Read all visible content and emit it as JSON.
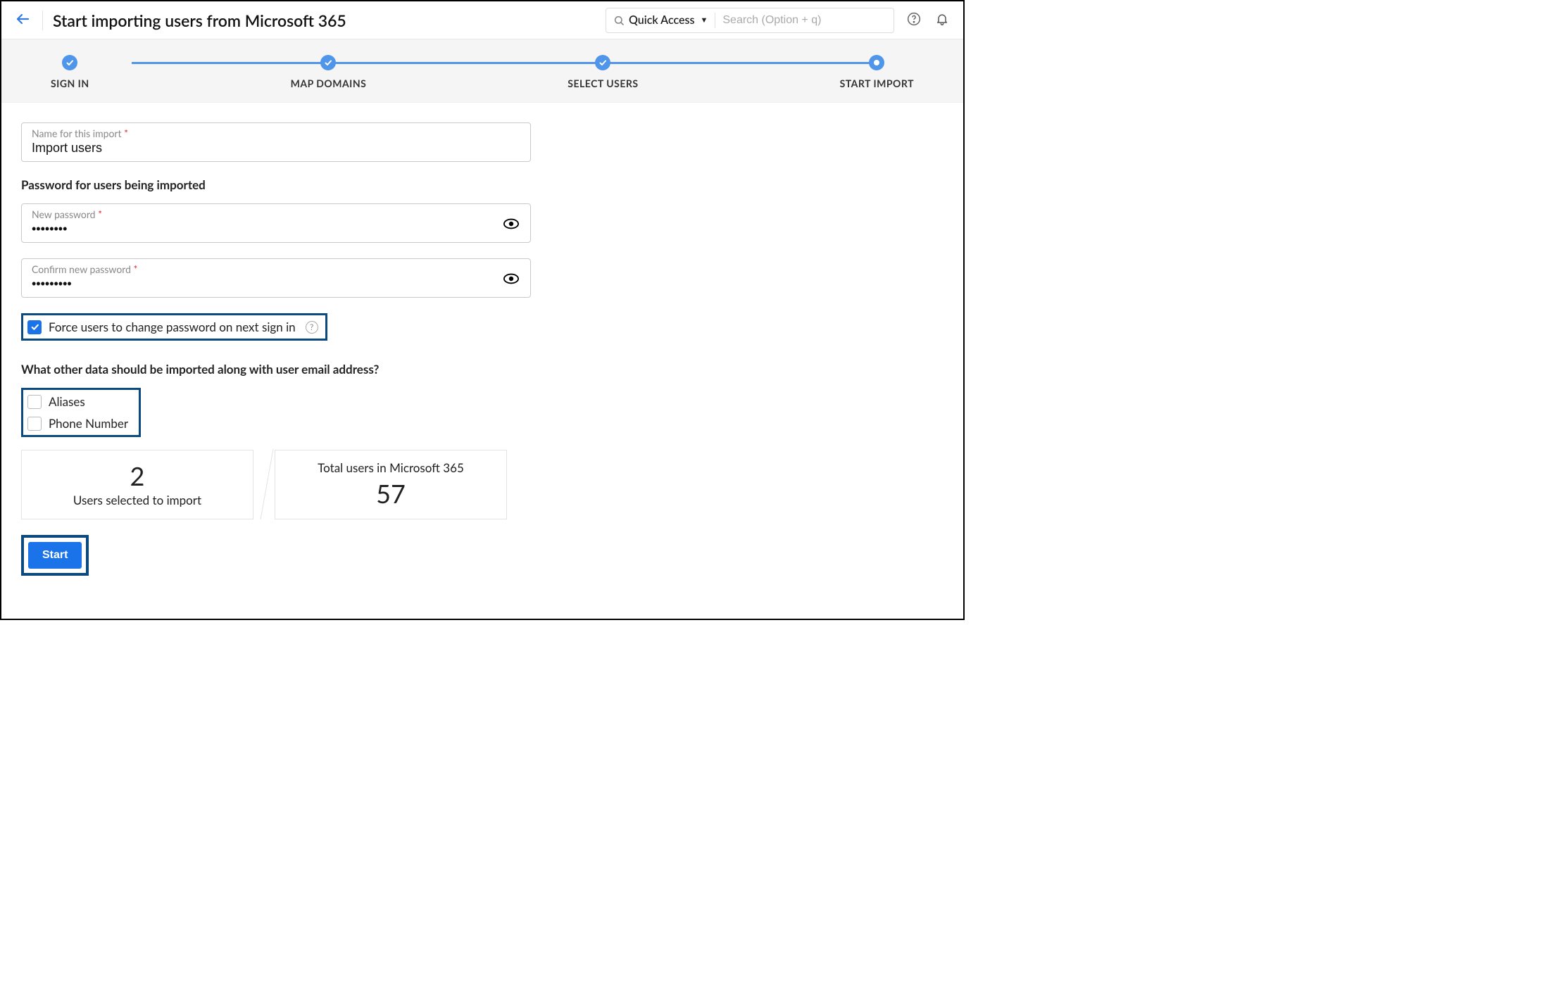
{
  "header": {
    "title": "Start importing users from Microsoft 365",
    "quick_access_label": "Quick Access",
    "search_placeholder": "Search (Option + q)"
  },
  "stepper": {
    "steps": [
      {
        "label": "SIGN IN",
        "state": "done"
      },
      {
        "label": "MAP DOMAINS",
        "state": "done"
      },
      {
        "label": "SELECT USERS",
        "state": "done"
      },
      {
        "label": "START IMPORT",
        "state": "current"
      }
    ]
  },
  "form": {
    "import_name_label": "Name for this import",
    "import_name_value": "Import users",
    "password_section_heading": "Password for users being imported",
    "new_password_label": "New password",
    "new_password_value": "••••••••",
    "confirm_password_label": "Confirm new password",
    "confirm_password_value": "•••••••••",
    "force_change_label": "Force users to change password on next sign in",
    "force_change_checked": true,
    "extras_heading": "What other data should be imported along with user email address?",
    "extras": [
      {
        "label": "Aliases",
        "checked": false
      },
      {
        "label": "Phone Number",
        "checked": false
      }
    ],
    "stats": {
      "selected_count": "2",
      "selected_label": "Users selected to import",
      "total_label": "Total users in Microsoft 365",
      "total_count": "57"
    },
    "start_label": "Start"
  }
}
